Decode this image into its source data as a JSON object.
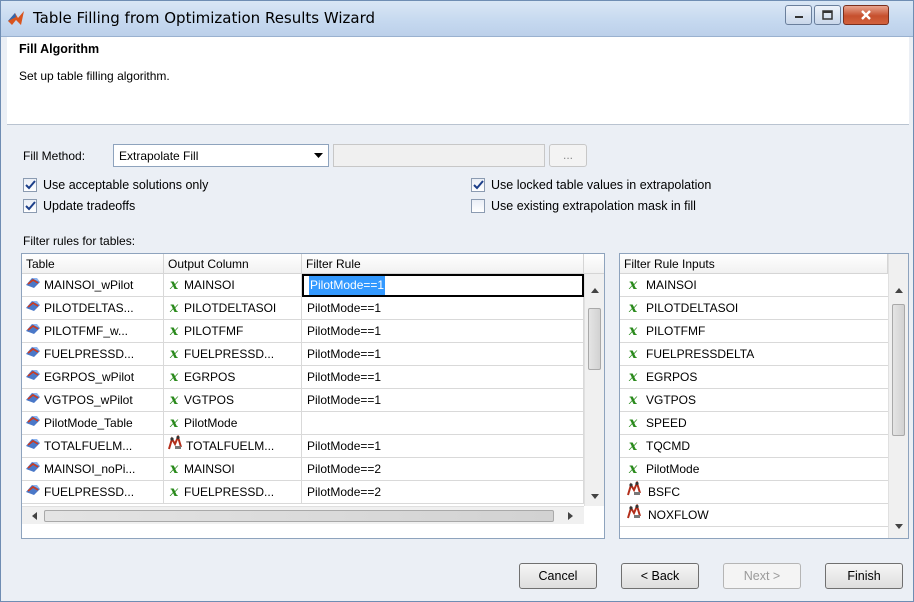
{
  "window": {
    "title": "Table Filling from Optimization Results Wizard"
  },
  "header": {
    "title": "Fill Algorithm",
    "description": "Set up table filling algorithm."
  },
  "fill_method": {
    "label": "Fill Method:",
    "value": "Extrapolate Fill",
    "browse_label": "..."
  },
  "checkboxes": [
    {
      "label": "Use acceptable solutions only",
      "checked": true
    },
    {
      "label": "Update tradeoffs",
      "checked": true
    },
    {
      "label": "Use locked table values in extrapolation",
      "checked": true
    },
    {
      "label": "Use existing extrapolation mask in fill",
      "checked": false
    }
  ],
  "filter_rules": {
    "label": "Filter rules for tables:",
    "columns": [
      "Table",
      "Output Column",
      "Filter Rule"
    ],
    "rows": [
      {
        "table": "MAINSOI_wPilot",
        "output": "MAINSOI",
        "output_icon": "x-variable-icon",
        "rule": "PilotMode==1"
      },
      {
        "table": "PILOTDELTAS...",
        "output": "PILOTDELTASOI",
        "output_icon": "x-variable-icon",
        "rule": "PilotMode==1"
      },
      {
        "table": "PILOTFMF_w...",
        "output": "PILOTFMF",
        "output_icon": "x-variable-icon",
        "rule": "PilotMode==1"
      },
      {
        "table": "FUELPRESSD...",
        "output": "FUELPRESSD...",
        "output_icon": "x-variable-icon",
        "rule": "PilotMode==1"
      },
      {
        "table": "EGRPOS_wPilot",
        "output": "EGRPOS",
        "output_icon": "x-variable-icon",
        "rule": "PilotMode==1"
      },
      {
        "table": "VGTPOS_wPilot",
        "output": "VGTPOS",
        "output_icon": "x-variable-icon",
        "rule": "PilotMode==1"
      },
      {
        "table": "PilotMode_Table",
        "output": "PilotMode",
        "output_icon": "x-variable-icon",
        "rule": ""
      },
      {
        "table": "TOTALFUELM...",
        "output": "TOTALFUELM...",
        "output_icon": "model-icon",
        "rule": "PilotMode==1"
      },
      {
        "table": "MAINSOI_noPi...",
        "output": "MAINSOI",
        "output_icon": "x-variable-icon",
        "rule": "PilotMode==2"
      },
      {
        "table": "FUELPRESSD...",
        "output": "FUELPRESSD...",
        "output_icon": "x-variable-icon",
        "rule": "PilotMode==2"
      }
    ]
  },
  "rule_inputs": {
    "header": "Filter Rule Inputs",
    "items": [
      {
        "label": "MAINSOI",
        "icon": "x-variable-icon"
      },
      {
        "label": "PILOTDELTASOI",
        "icon": "x-variable-icon"
      },
      {
        "label": "PILOTFMF",
        "icon": "x-variable-icon"
      },
      {
        "label": "FUELPRESSDELTA",
        "icon": "x-variable-icon"
      },
      {
        "label": "EGRPOS",
        "icon": "x-variable-icon"
      },
      {
        "label": "VGTPOS",
        "icon": "x-variable-icon"
      },
      {
        "label": "SPEED",
        "icon": "x-variable-icon"
      },
      {
        "label": "TQCMD",
        "icon": "x-variable-icon"
      },
      {
        "label": "PilotMode",
        "icon": "x-variable-icon"
      },
      {
        "label": "BSFC",
        "icon": "model-icon"
      },
      {
        "label": "NOXFLOW",
        "icon": "model-icon"
      }
    ]
  },
  "buttons": {
    "cancel": "Cancel",
    "back": "< Back",
    "next": "Next >",
    "finish": "Finish"
  },
  "colors": {
    "selection": "#3399ff",
    "x_icon": "#2a8a1c",
    "close_button": "#c6502e"
  }
}
